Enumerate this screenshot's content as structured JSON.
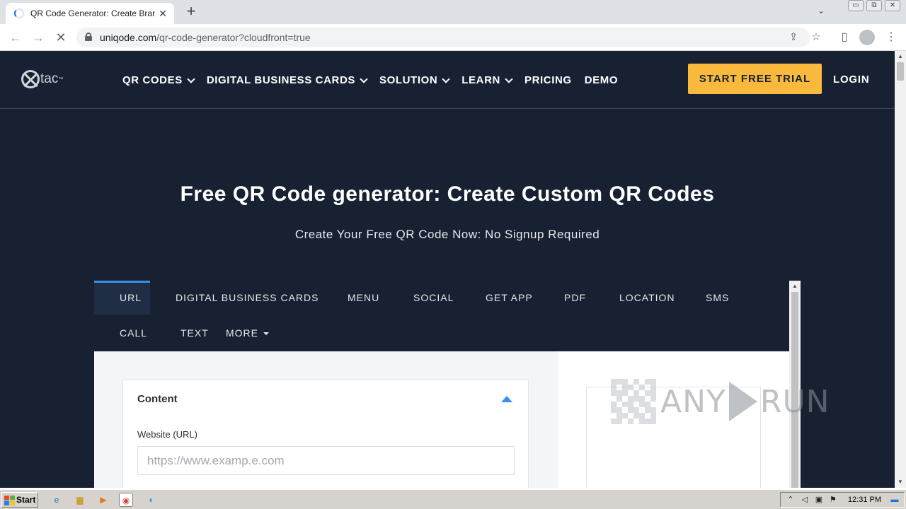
{
  "browser": {
    "tab_title": "QR Code Generator: Create Branded",
    "tab_close": "✕",
    "new_tab": "+",
    "url_domain": "uniqode.com",
    "url_path": "/qr-code-generator?cloudfront=true",
    "window_controls": [
      "▭",
      "⧉",
      "✕"
    ],
    "icons": [
      "back-icon",
      "forward-icon",
      "stop-loading-icon",
      "lock-icon",
      "share-icon",
      "star-icon",
      "side-panel-icon",
      "profile-icon",
      "more-menu-icon"
    ]
  },
  "site": {
    "logo_text": "tac",
    "logo_tm": "™",
    "nav": [
      {
        "label": "QR CODES",
        "has_dropdown": true
      },
      {
        "label": "DIGITAL BUSINESS CARDS",
        "has_dropdown": true
      },
      {
        "label": "SOLUTION",
        "has_dropdown": true
      },
      {
        "label": "LEARN",
        "has_dropdown": true
      },
      {
        "label": "PRICING",
        "has_dropdown": false
      },
      {
        "label": "DEMO",
        "has_dropdown": false
      }
    ],
    "cta_label": "START FREE TRIAL",
    "login_label": "LOGIN",
    "hero_title": "Free QR Code generator: Create Custom QR Codes",
    "hero_subtitle": "Create Your Free QR Code Now: No Signup Required",
    "accent_color": "#f8b93c",
    "background_color": "#182131"
  },
  "generator": {
    "tabs": [
      "URL",
      "DIGITAL BUSINESS CARDS",
      "MENU",
      "SOCIAL",
      "GET APP",
      "PDF",
      "LOCATION",
      "SMS",
      "CALL",
      "TEXT",
      "MORE"
    ],
    "active_tab": "URL",
    "content_title": "Content",
    "website_label": "Website (URL)",
    "website_placeholder": "https://www.examp.e.com",
    "website_value": ""
  },
  "watermark": {
    "text_left": "ANY",
    "text_right": "RUN"
  },
  "taskbar": {
    "start_label": "Start",
    "quick_launch": [
      "ie-icon",
      "folder-icon",
      "media-player-icon",
      "chrome-icon",
      "edge-icon"
    ],
    "clock": "12:31 PM"
  }
}
